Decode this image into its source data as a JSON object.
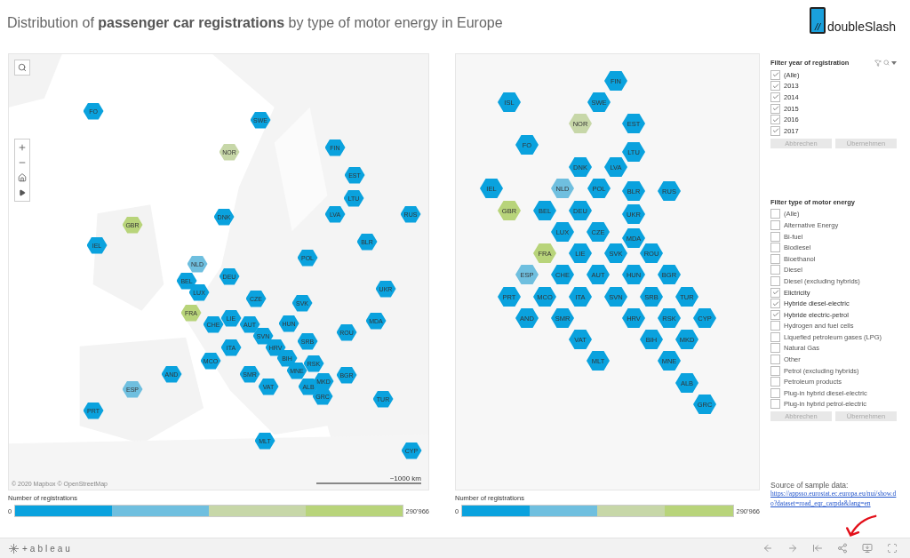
{
  "title": "Distribution of **passenger car registrations** by type of motor energy in Europe",
  "logo": {
    "mark": "//",
    "name": "doubleSlash"
  },
  "left_map": {
    "attribution": "© 2020 Mapbox  © OpenStreetMap",
    "scale": "~1000 km",
    "hexes": [
      {
        "label": "FO",
        "color": "#0aa2de"
      },
      {
        "label": "SWE",
        "color": "#0aa2de"
      },
      {
        "label": "NOR",
        "color": "#c7d7a8"
      },
      {
        "label": "FIN",
        "color": "#0aa2de"
      },
      {
        "label": "EST",
        "color": "#0aa2de"
      },
      {
        "label": "LTU",
        "color": "#0aa2de"
      },
      {
        "label": "LVA",
        "color": "#0aa2de"
      },
      {
        "label": "RUS",
        "color": "#0aa2de"
      },
      {
        "label": "DNK",
        "color": "#0aa2de"
      },
      {
        "label": "GBR",
        "color": "#b8d47a"
      },
      {
        "label": "IEL",
        "color": "#0aa2de"
      },
      {
        "label": "BLR",
        "color": "#0aa2de"
      },
      {
        "label": "POL",
        "color": "#0aa2de"
      },
      {
        "label": "NLD",
        "color": "#6fbfdf"
      },
      {
        "label": "BEL",
        "color": "#0aa2de"
      },
      {
        "label": "DEU",
        "color": "#0aa2de"
      },
      {
        "label": "UKR",
        "color": "#0aa2de"
      },
      {
        "label": "LUX",
        "color": "#0aa2de"
      },
      {
        "label": "CZE",
        "color": "#0aa2de"
      },
      {
        "label": "SVK",
        "color": "#0aa2de"
      },
      {
        "label": "FRA",
        "color": "#b8d47a"
      },
      {
        "label": "LIE",
        "color": "#0aa2de"
      },
      {
        "label": "CHE",
        "color": "#0aa2de"
      },
      {
        "label": "AUT",
        "color": "#0aa2de"
      },
      {
        "label": "HUN",
        "color": "#0aa2de"
      },
      {
        "label": "MDA",
        "color": "#0aa2de"
      },
      {
        "label": "ROU",
        "color": "#0aa2de"
      },
      {
        "label": "SVN",
        "color": "#0aa2de"
      },
      {
        "label": "SRB",
        "color": "#0aa2de"
      },
      {
        "label": "ITA",
        "color": "#0aa2de"
      },
      {
        "label": "HRV",
        "color": "#0aa2de"
      },
      {
        "label": "BIH",
        "color": "#0aa2de"
      },
      {
        "label": "RSK",
        "color": "#0aa2de"
      },
      {
        "label": "MNE",
        "color": "#0aa2de"
      },
      {
        "label": "MCO",
        "color": "#0aa2de"
      },
      {
        "label": "AND",
        "color": "#0aa2de"
      },
      {
        "label": "SMR",
        "color": "#0aa2de"
      },
      {
        "label": "BGR",
        "color": "#0aa2de"
      },
      {
        "label": "MKD",
        "color": "#0aa2de"
      },
      {
        "label": "VAT",
        "color": "#0aa2de"
      },
      {
        "label": "ALB",
        "color": "#0aa2de"
      },
      {
        "label": "GRC",
        "color": "#0aa2de"
      },
      {
        "label": "ESP",
        "color": "#6fbfdf"
      },
      {
        "label": "TUR",
        "color": "#0aa2de"
      },
      {
        "label": "PRT",
        "color": "#0aa2de"
      },
      {
        "label": "MLT",
        "color": "#0aa2de"
      },
      {
        "label": "CYP",
        "color": "#0aa2de"
      }
    ]
  },
  "left_legend": {
    "title": "Number of registrations",
    "min": "0",
    "max": "290'966",
    "steps": [
      {
        "color": "#0aa2de"
      },
      {
        "color": "#6fbfdf"
      },
      {
        "color": "#c7d7a8"
      },
      {
        "color": "#b8d47a"
      }
    ]
  },
  "right_map": {
    "hexes": [
      {
        "label": "FIN",
        "color": "#0aa2de"
      },
      {
        "label": "ISL",
        "color": "#0aa2de"
      },
      {
        "label": "SWE",
        "color": "#0aa2de"
      },
      {
        "label": "NOR",
        "color": "#c7d7a8"
      },
      {
        "label": "EST",
        "color": "#0aa2de"
      },
      {
        "label": "FO",
        "color": "#0aa2de"
      },
      {
        "label": "LTU",
        "color": "#0aa2de"
      },
      {
        "label": "DNK",
        "color": "#0aa2de"
      },
      {
        "label": "LVA",
        "color": "#0aa2de"
      },
      {
        "label": "IEL",
        "color": "#0aa2de"
      },
      {
        "label": "NLD",
        "color": "#6fbfdf"
      },
      {
        "label": "POL",
        "color": "#0aa2de"
      },
      {
        "label": "BLR",
        "color": "#0aa2de"
      },
      {
        "label": "RUS",
        "color": "#0aa2de"
      },
      {
        "label": "GBR",
        "color": "#b8d47a"
      },
      {
        "label": "BEL",
        "color": "#0aa2de"
      },
      {
        "label": "DEU",
        "color": "#0aa2de"
      },
      {
        "label": "UKR",
        "color": "#0aa2de"
      },
      {
        "label": "LUX",
        "color": "#0aa2de"
      },
      {
        "label": "CZE",
        "color": "#0aa2de"
      },
      {
        "label": "MDA",
        "color": "#0aa2de"
      },
      {
        "label": "FRA",
        "color": "#b8d47a"
      },
      {
        "label": "LIE",
        "color": "#0aa2de"
      },
      {
        "label": "SVK",
        "color": "#0aa2de"
      },
      {
        "label": "ROU",
        "color": "#0aa2de"
      },
      {
        "label": "ESP",
        "color": "#6fbfdf"
      },
      {
        "label": "CHE",
        "color": "#0aa2de"
      },
      {
        "label": "AUT",
        "color": "#0aa2de"
      },
      {
        "label": "HUN",
        "color": "#0aa2de"
      },
      {
        "label": "BGR",
        "color": "#0aa2de"
      },
      {
        "label": "PRT",
        "color": "#0aa2de"
      },
      {
        "label": "MCO",
        "color": "#0aa2de"
      },
      {
        "label": "ITA",
        "color": "#0aa2de"
      },
      {
        "label": "SVN",
        "color": "#0aa2de"
      },
      {
        "label": "SRB",
        "color": "#0aa2de"
      },
      {
        "label": "TUR",
        "color": "#0aa2de"
      },
      {
        "label": "AND",
        "color": "#0aa2de"
      },
      {
        "label": "SMR",
        "color": "#0aa2de"
      },
      {
        "label": "HRV",
        "color": "#0aa2de"
      },
      {
        "label": "RSK",
        "color": "#0aa2de"
      },
      {
        "label": "CYP",
        "color": "#0aa2de"
      },
      {
        "label": "VAT",
        "color": "#0aa2de"
      },
      {
        "label": "BIH",
        "color": "#0aa2de"
      },
      {
        "label": "MKD",
        "color": "#0aa2de"
      },
      {
        "label": "MLT",
        "color": "#0aa2de"
      },
      {
        "label": "MNE",
        "color": "#0aa2de"
      },
      {
        "label": "ALB",
        "color": "#0aa2de"
      },
      {
        "label": "GRC",
        "color": "#0aa2de"
      }
    ]
  },
  "right_legend": {
    "title": "Number of registrations",
    "min": "0",
    "max": "290'966",
    "steps": [
      {
        "color": "#0aa2de"
      },
      {
        "color": "#6fbfdf"
      },
      {
        "color": "#c7d7a8"
      },
      {
        "color": "#b8d47a"
      }
    ]
  },
  "filters": [
    {
      "title": "Filter year of registration",
      "tools": true,
      "items": [
        {
          "label": "(Alle)",
          "checked": true
        },
        {
          "label": "2013",
          "checked": true
        },
        {
          "label": "2014",
          "checked": true
        },
        {
          "label": "2015",
          "checked": true
        },
        {
          "label": "2016",
          "checked": true
        },
        {
          "label": "2017",
          "checked": true
        }
      ],
      "buttons": [
        {
          "label": "Abbrechen",
          "disabled": true
        },
        {
          "label": "Übernehmen",
          "disabled": true
        }
      ]
    },
    {
      "title": "Filter type of motor energy",
      "tools": false,
      "items": [
        {
          "label": "(Alle)",
          "checked": false
        },
        {
          "label": "Alternative Energy",
          "checked": false
        },
        {
          "label": "Bi-fuel",
          "checked": false
        },
        {
          "label": "Biodiesel",
          "checked": false
        },
        {
          "label": "Bioethanol",
          "checked": false
        },
        {
          "label": "Diesel",
          "checked": false
        },
        {
          "label": "Diesel (excluding hybrids)",
          "checked": false
        },
        {
          "label": "Elictricity",
          "checked": true
        },
        {
          "label": "Hybride diesel-electric",
          "checked": true
        },
        {
          "label": "Hybride electric-petrol",
          "checked": true
        },
        {
          "label": "Hydrogen and fuel cells",
          "checked": false
        },
        {
          "label": "Liquefied petroleum gases (LPG)",
          "checked": false
        },
        {
          "label": "Natural Gas",
          "checked": false
        },
        {
          "label": "Other",
          "checked": false
        },
        {
          "label": "Petrol (excluding hybrids)",
          "checked": false
        },
        {
          "label": "Petroleum products",
          "checked": false
        },
        {
          "label": "Plug-in hybrid diesel-electric",
          "checked": false
        },
        {
          "label": "Plug-in hybrid petrol-electric",
          "checked": false
        }
      ],
      "buttons": [
        {
          "label": "Abbrechen",
          "disabled": true
        },
        {
          "label": "Übernehmen",
          "disabled": true
        }
      ]
    }
  ],
  "source": {
    "label": "Source of sample data:",
    "link": "https://appsso.eurostat.ec.europa.eu/nui/show.do?dataset=road_eqr_carpda&lang=en"
  },
  "toolbar": {
    "brand": "+ableau"
  }
}
